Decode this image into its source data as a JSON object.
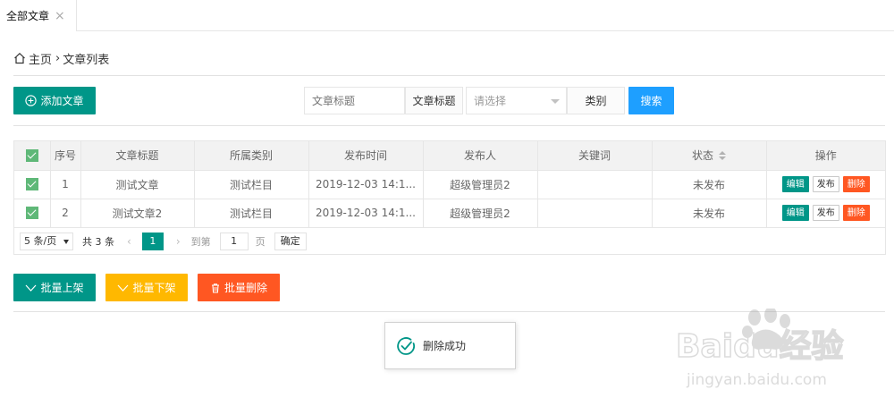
{
  "tab": {
    "label": "全部文章",
    "close": "×"
  },
  "breadcrumb": {
    "home": "主页",
    "separator": "›",
    "current": "文章列表"
  },
  "toolbar": {
    "add_label": "添加文章"
  },
  "search": {
    "title_placeholder": "文章标题",
    "title_label": "文章标题",
    "select_placeholder": "请选择",
    "category_label": "类别",
    "search_label": "搜索"
  },
  "table": {
    "headers": [
      "序号",
      "文章标题",
      "所属类别",
      "发布时间",
      "发布人",
      "关键词",
      "状态",
      "操作"
    ],
    "rows": [
      {
        "index": "1",
        "title": "测试文章",
        "category": "测试栏目",
        "time": "2019-12-03 14:1...",
        "author": "超级管理员2",
        "keywords": "",
        "status": "未发布"
      },
      {
        "index": "2",
        "title": "测试文章2",
        "category": "测试栏目",
        "time": "2019-12-03 14:1...",
        "author": "超级管理员2",
        "keywords": "",
        "status": "未发布"
      }
    ],
    "actions": {
      "edit": "编辑",
      "publish": "发布",
      "delete": "删除"
    }
  },
  "pager": {
    "page_size": "5 条/页",
    "total": "共 3 条",
    "prev": "‹",
    "current": "1",
    "next": "›",
    "goto": "到第",
    "goto_value": "1",
    "page_unit": "页",
    "confirm": "确定"
  },
  "batch": {
    "on_shelf": "批量上架",
    "off_shelf": "批量下架",
    "delete": "批量删除"
  },
  "toast": {
    "message": "删除成功"
  },
  "watermark": {
    "brand": "Baidu经验",
    "url": "jingyan.baidu.com"
  },
  "colors": {
    "primary": "#009688",
    "warm": "#ffb800",
    "danger": "#ff5722",
    "normal": "#1e9fff",
    "check": "#5fb878"
  }
}
